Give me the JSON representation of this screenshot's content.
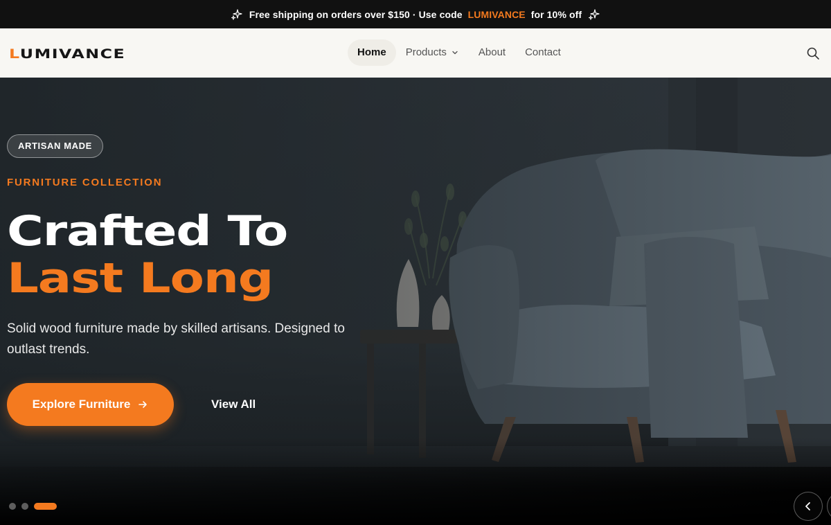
{
  "announcement": {
    "before": "Free shipping on orders over $150 · Use code ",
    "code": "LUMIVANCE",
    "after": " for 10% off",
    "icon": "sparkle-icon"
  },
  "brand": {
    "logo_lead": "L",
    "logo_rest": "UMIVANCE",
    "accent": "#f47a1f"
  },
  "nav": {
    "items": [
      {
        "label": "Home",
        "active": true
      },
      {
        "label": "Products",
        "has_dropdown": true
      },
      {
        "label": "About"
      },
      {
        "label": "Contact"
      }
    ],
    "search_icon": "search-icon"
  },
  "hero": {
    "badge": "ARTISAN MADE",
    "eyebrow": "FURNITURE COLLECTION",
    "heading_line1": "Crafted To",
    "heading_line2": "Last Long",
    "subtitle": "Solid wood furniture made by skilled artisans. Designed to outlast trends.",
    "cta_primary": "Explore Furniture",
    "cta_secondary": "View All"
  },
  "carousel": {
    "slide_count": 3,
    "active_index": 2,
    "prev_icon": "chevron-left-icon"
  }
}
